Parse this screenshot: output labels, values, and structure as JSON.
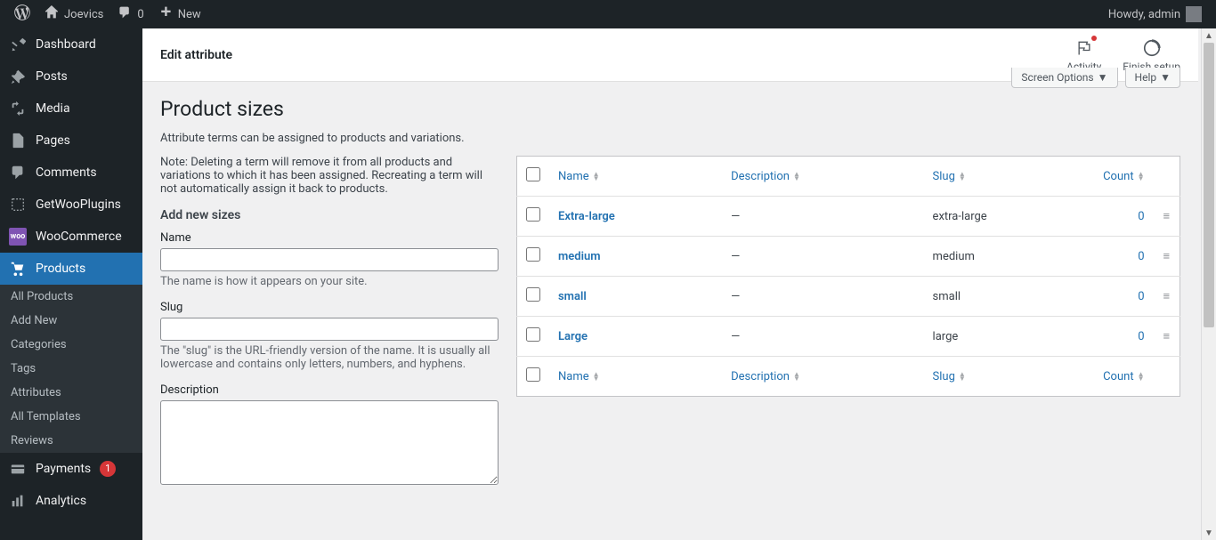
{
  "adminbar": {
    "site_name": "Joevics",
    "comment_count": "0",
    "new_label": "New",
    "greeting": "Howdy, admin"
  },
  "sidebar": {
    "items": [
      {
        "label": "Dashboard",
        "icon": "dashboard"
      },
      {
        "label": "Posts",
        "icon": "pin"
      },
      {
        "label": "Media",
        "icon": "media"
      },
      {
        "label": "Pages",
        "icon": "pages"
      },
      {
        "label": "Comments",
        "icon": "comments"
      },
      {
        "label": "GetWooPlugins",
        "icon": "plugin"
      },
      {
        "label": "WooCommerce",
        "icon": "woo"
      },
      {
        "label": "Products",
        "icon": "products",
        "current": true
      },
      {
        "label": "Payments",
        "icon": "payments",
        "badge": "1"
      },
      {
        "label": "Analytics",
        "icon": "analytics"
      }
    ],
    "submenu": [
      {
        "label": "All Products"
      },
      {
        "label": "Add New"
      },
      {
        "label": "Categories"
      },
      {
        "label": "Tags"
      },
      {
        "label": "Attributes"
      },
      {
        "label": "All Templates"
      },
      {
        "label": "Reviews"
      }
    ]
  },
  "topbar": {
    "title": "Edit attribute",
    "activity_label": "Activity",
    "finish_label": "Finish setup"
  },
  "tabs": {
    "screen_options": "Screen Options",
    "help": "Help"
  },
  "page": {
    "title": "Product sizes",
    "intro": "Attribute terms can be assigned to products and variations.",
    "note": "Note: Deleting a term will remove it from all products and variations to which it has been assigned. Recreating a term will not automatically assign it back to products.",
    "form_title": "Add new sizes",
    "name_label": "Name",
    "name_helper": "The name is how it appears on your site.",
    "slug_label": "Slug",
    "slug_helper": "The \"slug\" is the URL-friendly version of the name. It is usually all lowercase and contains only letters, numbers, and hyphens.",
    "description_label": "Description"
  },
  "table": {
    "col_name": "Name",
    "col_description": "Description",
    "col_slug": "Slug",
    "col_count": "Count",
    "rows": [
      {
        "name": "Extra-large",
        "description": "—",
        "slug": "extra-large",
        "count": "0"
      },
      {
        "name": "medium",
        "description": "—",
        "slug": "medium",
        "count": "0"
      },
      {
        "name": "small",
        "description": "—",
        "slug": "small",
        "count": "0"
      },
      {
        "name": "Large",
        "description": "—",
        "slug": "large",
        "count": "0"
      }
    ]
  }
}
